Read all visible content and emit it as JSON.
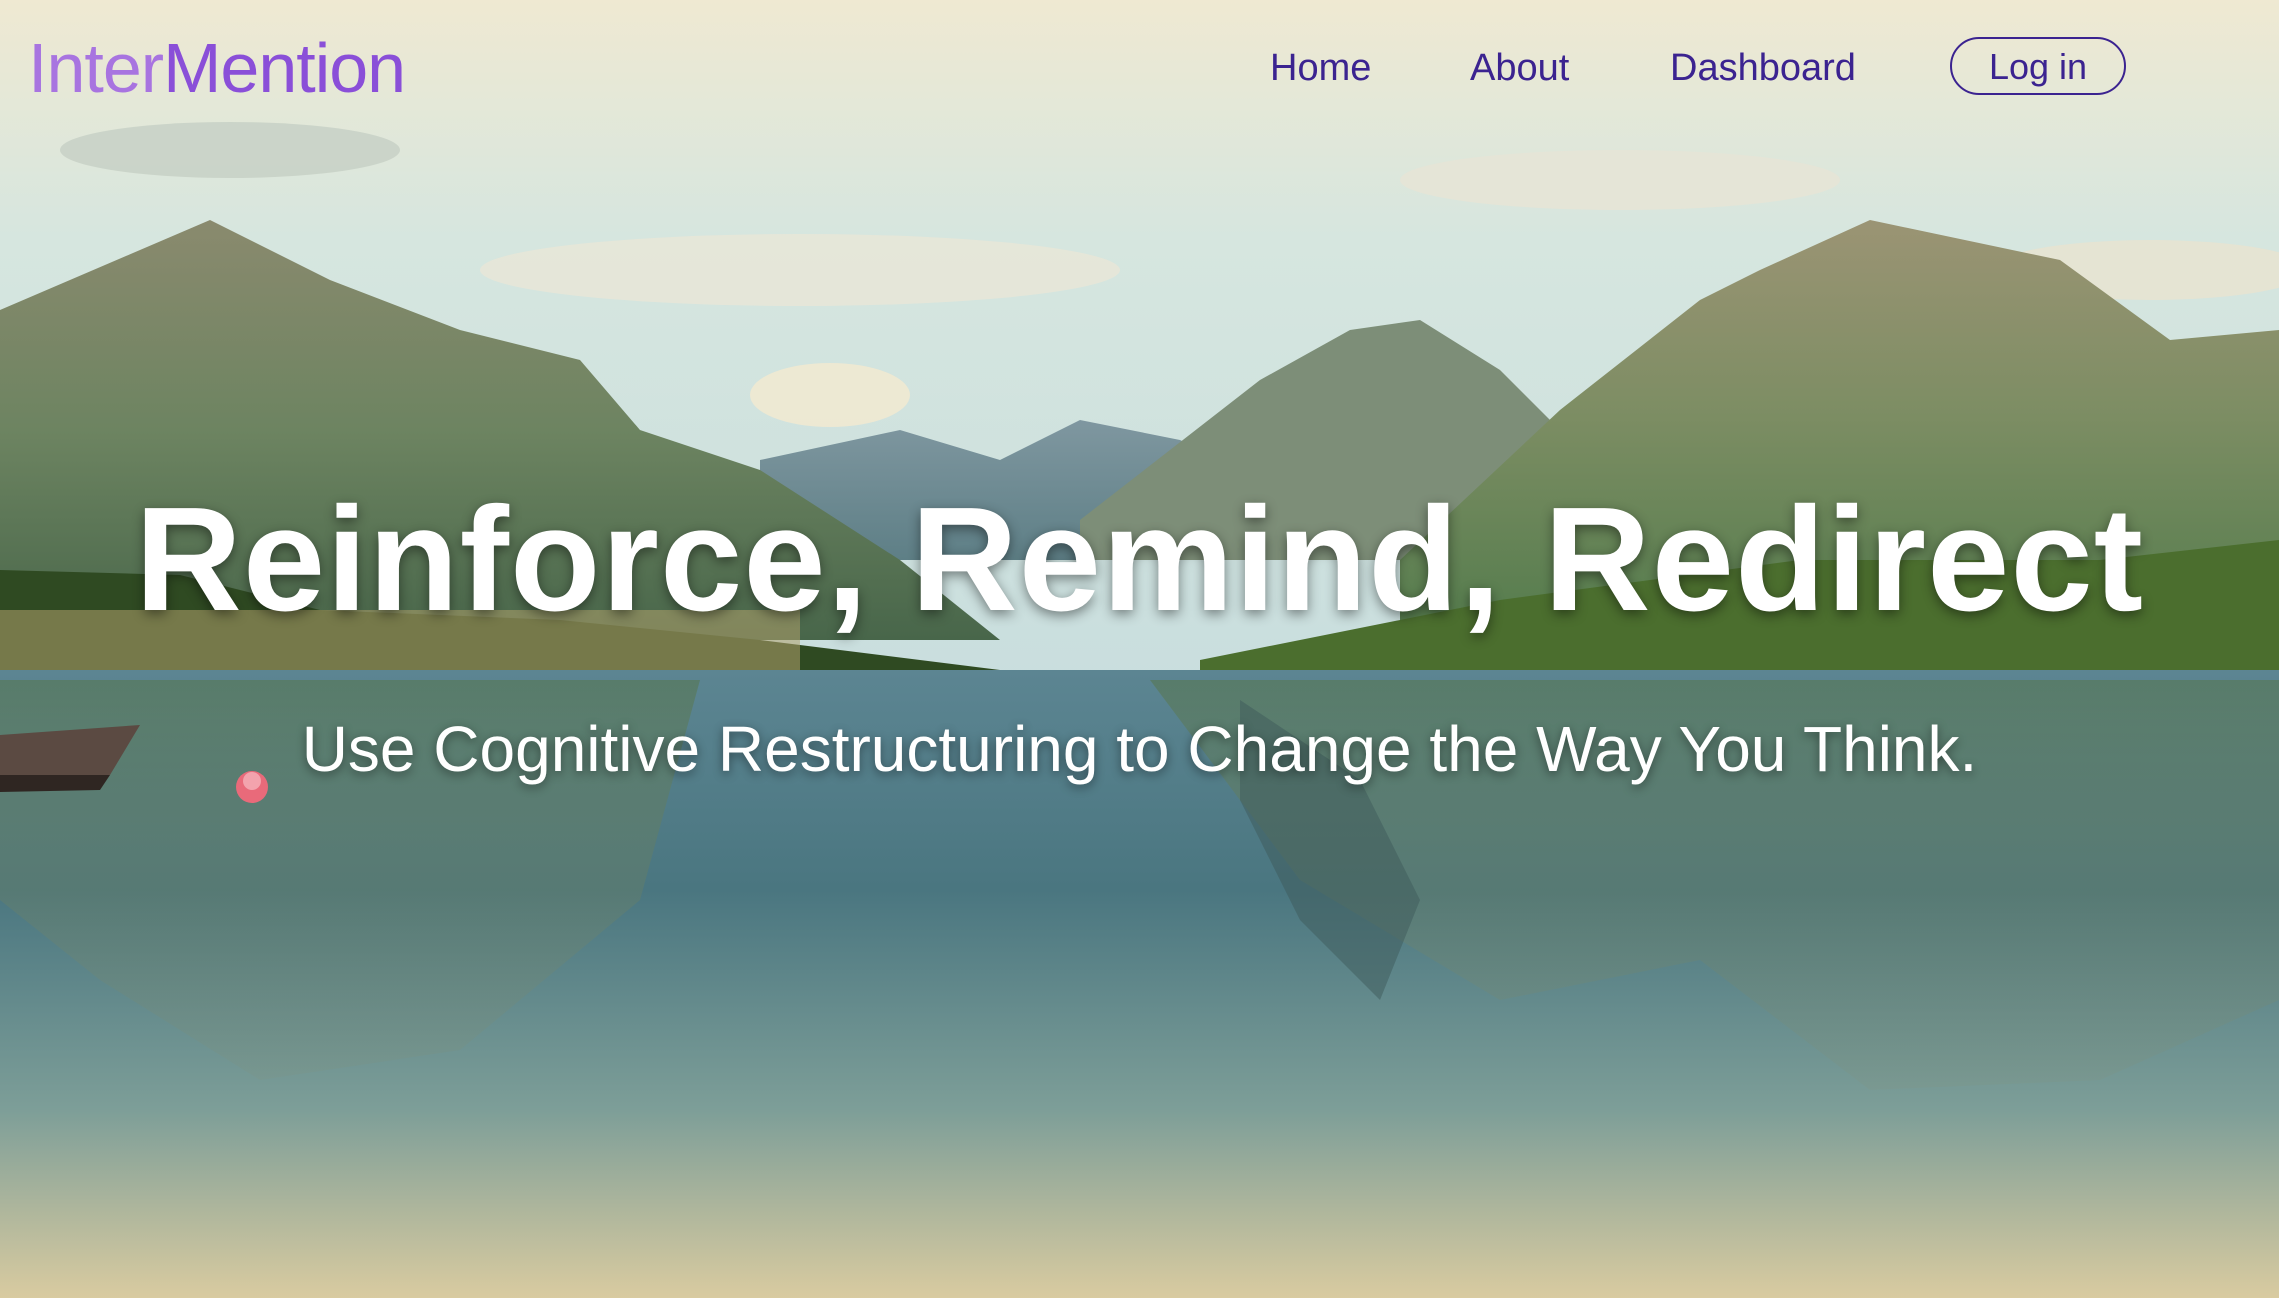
{
  "brand": {
    "name_part1": "Inter",
    "name_part2": "Mention",
    "color_part1": "#a874e0",
    "color_part2": "#8a4fd8"
  },
  "nav": {
    "items": [
      {
        "label": "Home"
      },
      {
        "label": "About"
      },
      {
        "label": "Dashboard"
      }
    ],
    "login_label": "Log in",
    "link_color": "#3b2390"
  },
  "hero": {
    "headline": "Reinforce, Remind, Redirect",
    "subheadline": "Use Cognitive Restructuring to Change the Way You Think.",
    "background": "mountain-lake-photo"
  }
}
